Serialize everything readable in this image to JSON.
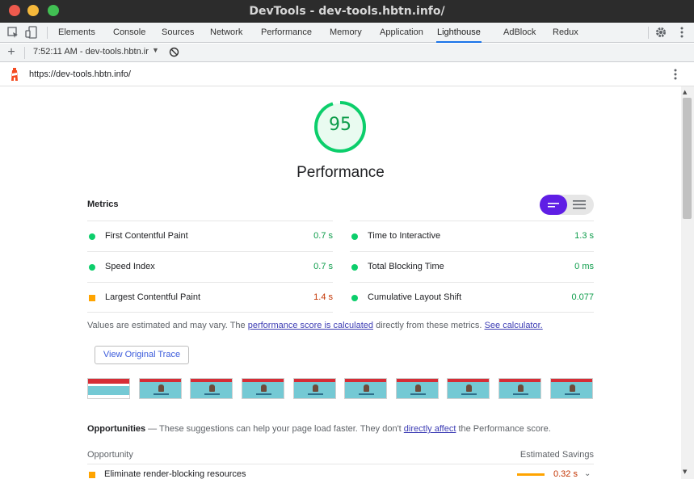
{
  "window": {
    "title": "DevTools - dev-tools.hbtn.info/"
  },
  "devtools_tabs": [
    "Elements",
    "Console",
    "Sources",
    "Network",
    "Performance",
    "Memory",
    "Application",
    "Lighthouse",
    "AdBlock",
    "Redux"
  ],
  "active_tab": "Lighthouse",
  "lighthouse_toolbar": {
    "report_label": "7:52:11 AM - dev-tools.hbtn.ir"
  },
  "url_bar": {
    "url": "https://dev-tools.hbtn.info/"
  },
  "score": {
    "value": "95",
    "category": "Performance",
    "color": "#0cce6b"
  },
  "metrics": {
    "heading": "Metrics",
    "left": [
      {
        "label": "First Contentful Paint",
        "value": "0.7 s",
        "status": "pass"
      },
      {
        "label": "Speed Index",
        "value": "0.7 s",
        "status": "pass"
      },
      {
        "label": "Largest Contentful Paint",
        "value": "1.4 s",
        "status": "average"
      }
    ],
    "right": [
      {
        "label": "Time to Interactive",
        "value": "1.3 s",
        "status": "pass"
      },
      {
        "label": "Total Blocking Time",
        "value": "0 ms",
        "status": "pass"
      },
      {
        "label": "Cumulative Layout Shift",
        "value": "0.077",
        "status": "pass"
      }
    ]
  },
  "note": {
    "prefix": "Values are estimated and may vary. The ",
    "link1": "performance score is calculated",
    "middle": " directly from these metrics. ",
    "link2": "See calculator."
  },
  "trace_button": "View Original Trace",
  "opportunities": {
    "title": "Opportunities",
    "desc_prefix": " — These suggestions can help your page load faster. They don't ",
    "desc_link": "directly affect",
    "desc_suffix": " the Performance score.",
    "col_opportunity": "Opportunity",
    "col_savings": "Estimated Savings",
    "items": [
      {
        "label": "Eliminate render-blocking resources",
        "savings": "0.32 s"
      }
    ]
  },
  "colors": {
    "pass": "#0cce6b",
    "average": "#ffa400",
    "accent": "#5f1ee5"
  }
}
